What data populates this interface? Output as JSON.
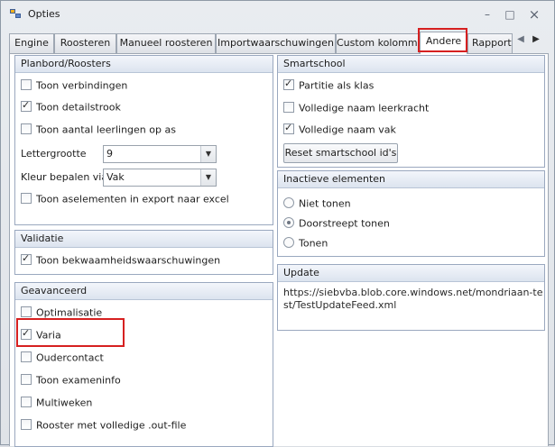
{
  "window": {
    "title": "Opties"
  },
  "tabs": [
    {
      "label": "Engine"
    },
    {
      "label": "Roosteren"
    },
    {
      "label": "Manueel roosteren"
    },
    {
      "label": "Importwaarschuwingen"
    },
    {
      "label": "Custom kolommen"
    },
    {
      "label": "Andere",
      "active": true
    },
    {
      "label": "Rapportla"
    }
  ],
  "planbord": {
    "title": "Planbord/Roosters",
    "toon_verbindingen": {
      "label": "Toon verbindingen",
      "checked": false
    },
    "toon_detailstrook": {
      "label": "Toon detailstrook",
      "checked": true
    },
    "toon_aantal": {
      "label": "Toon aantal leerlingen op as",
      "checked": false
    },
    "lettergrootte": {
      "label": "Lettergrootte",
      "value": "9"
    },
    "kleur": {
      "label": "Kleur bepalen via",
      "value": "Vak"
    },
    "toon_aselementen": {
      "label": "Toon aselementen in export naar excel",
      "checked": false
    }
  },
  "validatie": {
    "title": "Validatie",
    "toon_bekwaamheid": {
      "label": "Toon bekwaamheidswaarschuwingen",
      "checked": true
    }
  },
  "geavanceerd": {
    "title": "Geavanceerd",
    "optimalisatie": {
      "label": "Optimalisatie",
      "checked": false
    },
    "varia": {
      "label": "Varia",
      "checked": true
    },
    "oudercontact": {
      "label": "Oudercontact",
      "checked": false
    },
    "toon_exameninfo": {
      "label": "Toon exameninfo",
      "checked": false
    },
    "multiweken": {
      "label": "Multiweken",
      "checked": false
    },
    "rooster_out": {
      "label": "Rooster met volledige .out-file",
      "checked": false
    }
  },
  "smartschool": {
    "title": "Smartschool",
    "partitie": {
      "label": "Partitie als klas",
      "checked": true
    },
    "volledige_leerkracht": {
      "label": "Volledige naam leerkracht",
      "checked": false
    },
    "volledige_vak": {
      "label": "Volledige naam vak",
      "checked": true
    },
    "reset_button": "Reset smartschool id's"
  },
  "inactieve": {
    "title": "Inactieve elementen",
    "options": [
      {
        "label": "Niet tonen",
        "selected": false
      },
      {
        "label": "Doorstreept tonen",
        "selected": true
      },
      {
        "label": "Tonen",
        "selected": false
      }
    ]
  },
  "update": {
    "title": "Update",
    "url": "https://siebvba.blob.core.windows.net/mondriaan-test/TestUpdateFeed.xml"
  },
  "colors": {
    "highlight": "#d62020",
    "group_border": "#9aa8bf"
  },
  "icons": {
    "check": "✓",
    "minimize": "–",
    "maximize": "□",
    "close": "×",
    "scroll_left": "◀",
    "scroll_right": "▶",
    "dropdown": "▼"
  }
}
